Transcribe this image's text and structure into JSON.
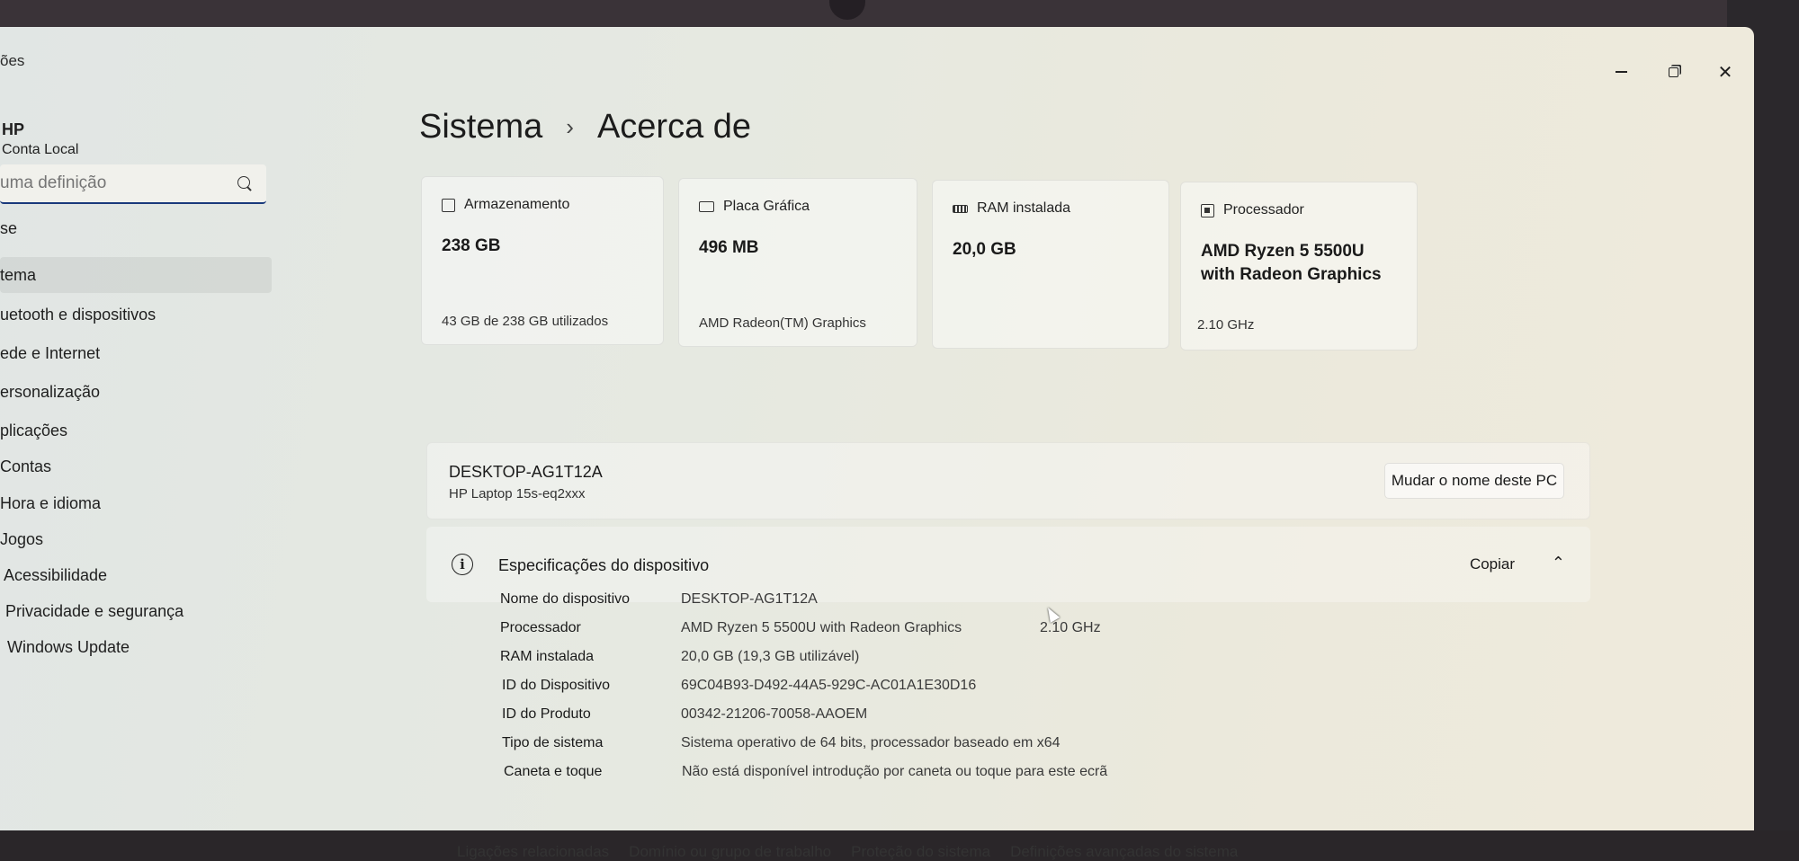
{
  "window": {
    "title_fragment": "ões",
    "minimize_label": "",
    "maximize_label": "",
    "close_label": "✕"
  },
  "sidebar": {
    "user_name": "HP",
    "user_sub": "Conta Local",
    "search_placeholder": "uma definição",
    "items": [
      {
        "label": "se"
      },
      {
        "label": "tema"
      },
      {
        "label": "uetooth e dispositivos"
      },
      {
        "label": "ede e Internet"
      },
      {
        "label": "ersonalização"
      },
      {
        "label": "plicações"
      },
      {
        "label": "Contas"
      },
      {
        "label": "Hora e idioma"
      },
      {
        "label": "Jogos"
      },
      {
        "label": "Acessibilidade"
      },
      {
        "label": "Privacidade e segurança"
      },
      {
        "label": "Windows Update"
      }
    ]
  },
  "breadcrumb": {
    "parent": "Sistema",
    "separator": "›",
    "current": "Acerca de"
  },
  "cards": [
    {
      "title": "Armazenamento",
      "icon": "storage-icon",
      "value": "238 GB",
      "sub": "43 GB de 238 GB utilizados"
    },
    {
      "title": "Placa Gráfica",
      "icon": "gpu-icon",
      "value": "496 MB",
      "sub": "AMD Radeon(TM) Graphics"
    },
    {
      "title": "RAM instalada",
      "icon": "ram-icon",
      "value": "20,0 GB",
      "sub": ""
    },
    {
      "title": "Processador",
      "icon": "cpu-icon",
      "value_line1": "AMD Ryzen 5 5500U",
      "value_line2": "with Radeon Graphics",
      "sub": "2.10 GHz"
    }
  ],
  "pc": {
    "name": "DESKTOP-AG1T12A",
    "model": "HP Laptop 15s-eq2xxx",
    "rename_label": "Mudar o nome deste PC"
  },
  "specs": {
    "title": "Especificações do dispositivo",
    "copy_label": "Copiar",
    "chevron": "⌃",
    "rows": [
      {
        "label": "Nome do dispositivo",
        "value": "DESKTOP-AG1T12A",
        "extra": ""
      },
      {
        "label": "Processador",
        "value": "AMD Ryzen 5 5500U with Radeon Graphics",
        "extra": "2.10 GHz"
      },
      {
        "label": "RAM instalada",
        "value": "20,0 GB (19,3 GB utilizável)",
        "extra": ""
      },
      {
        "label": "ID do Dispositivo",
        "value": "69C04B93-D492-44A5-929C-AC01A1E30D16",
        "extra": ""
      },
      {
        "label": "ID do Produto",
        "value": "00342-21206-70058-AAOEM",
        "extra": ""
      },
      {
        "label": "Tipo de sistema",
        "value": "Sistema operativo de 64 bits, processador baseado em x64",
        "extra": ""
      },
      {
        "label": "Caneta e toque",
        "value": "Não está disponível introdução por caneta ou toque para este ecrã",
        "extra": ""
      }
    ]
  },
  "related_links": [
    "Ligações relacionadas",
    "Domínio ou grupo de trabalho",
    "Proteção do sistema",
    "Definições avançadas do sistema"
  ]
}
